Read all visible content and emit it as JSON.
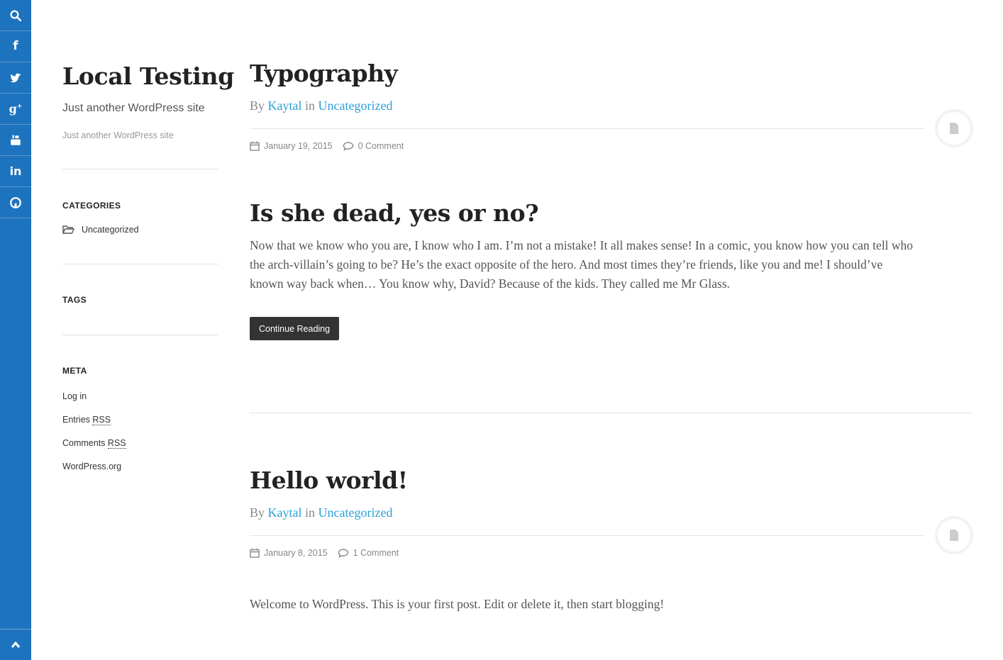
{
  "social": {
    "items": [
      {
        "name": "search-icon"
      },
      {
        "name": "facebook-icon"
      },
      {
        "name": "twitter-icon"
      },
      {
        "name": "google-plus-icon"
      },
      {
        "name": "youtube-icon"
      },
      {
        "name": "linkedin-icon"
      },
      {
        "name": "github-icon"
      }
    ],
    "back_to_top": "chevron-up-icon",
    "bar_color": "#1e73be"
  },
  "site": {
    "title": "Local Testing",
    "description": "Just another WordPress site",
    "description_small": "Just another WordPress site"
  },
  "widgets": {
    "categories": {
      "title": "CATEGORIES",
      "items": [
        "Uncategorized"
      ]
    },
    "tags": {
      "title": "TAGS"
    },
    "meta": {
      "title": "META",
      "log_in": "Log in",
      "entries_prefix": "Entries",
      "entries_rss": "RSS",
      "comments_prefix": "Comments",
      "comments_rss": "RSS",
      "wordpress_org": "WordPress.org"
    }
  },
  "posts": [
    {
      "title": "Typography",
      "by": "By",
      "author": "Kaytal",
      "in": "in",
      "category": "Uncategorized",
      "date": "January 19, 2015",
      "comments": "0 Comment"
    },
    {
      "title": "Is she dead, yes or no?",
      "excerpt_line1": "Now that we know who you are, I know who I am. I’m not a mistake! It all makes sense! In a comic, you know how you can tell who",
      "excerpt_line2": "the arch-villain’s going to be? He’s the exact opposite of the hero. And most times they’re friends, like you and me! I should’ve",
      "excerpt_line3": "known way back when… You know why, David? Because of the kids. They called me Mr Glass.",
      "button": "Continue Reading"
    },
    {
      "title": "Hello world!",
      "by": "By",
      "author": "Kaytal",
      "in": "in",
      "category": "Uncategorized",
      "date": "January 8, 2015",
      "comments": "1 Comment",
      "content": "Welcome to WordPress. This is your first post. Edit or delete it, then start blogging!"
    }
  ],
  "colors": {
    "accent": "#2aa0d8",
    "button_bg": "#333333"
  }
}
